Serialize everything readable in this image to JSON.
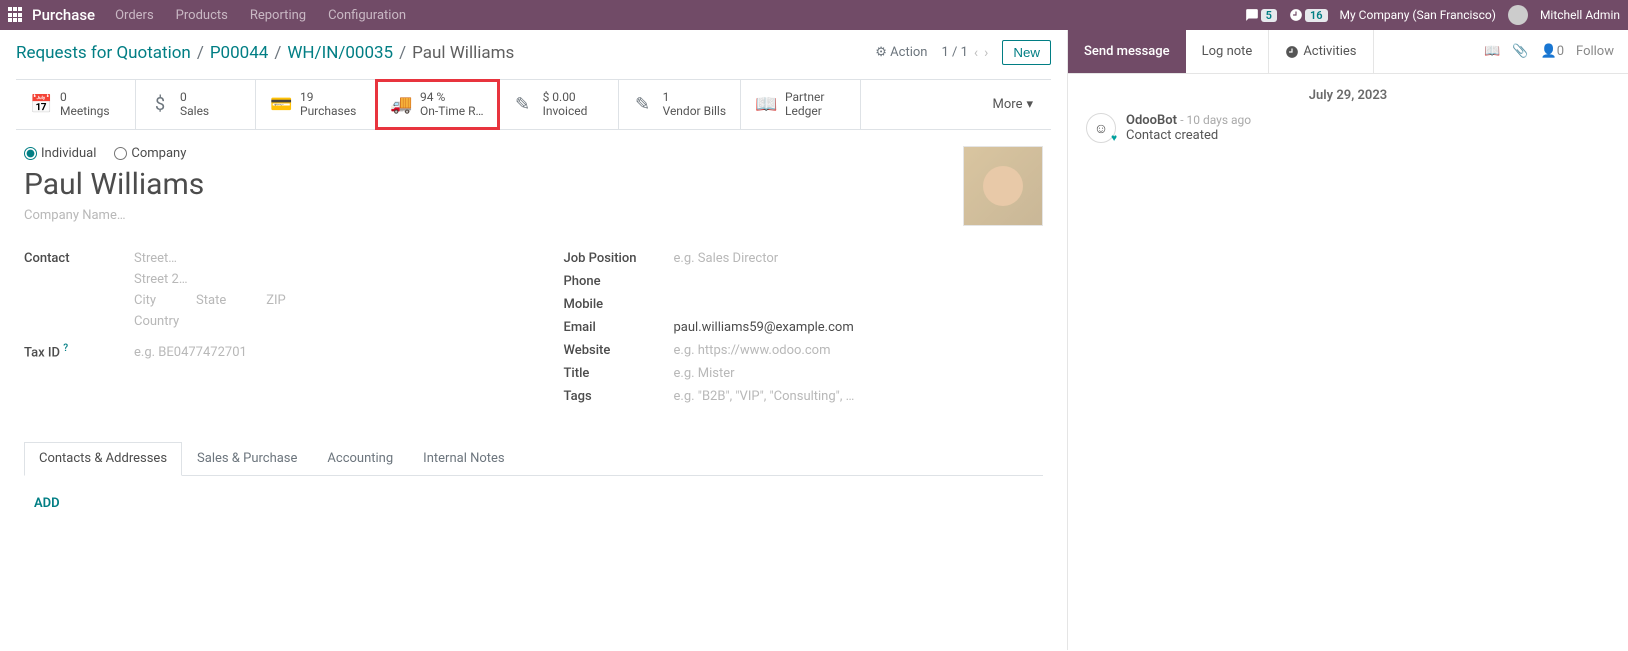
{
  "topbar": {
    "brand": "Purchase",
    "menu": [
      "Orders",
      "Products",
      "Reporting",
      "Configuration"
    ],
    "chat_count": "5",
    "clock_count": "16",
    "company": "My Company (San Francisco)",
    "user": "Mitchell Admin"
  },
  "breadcrumb": {
    "items": [
      "Requests for Quotation",
      "P00044",
      "WH/IN/00035"
    ],
    "current": "Paul Williams",
    "action_label": "Action",
    "pager": "1 / 1",
    "new_label": "New"
  },
  "stats": {
    "meetings": {
      "value": "0",
      "label": "Meetings"
    },
    "sales": {
      "value": "0",
      "label": "Sales"
    },
    "purchases": {
      "value": "19",
      "label": "Purchases"
    },
    "ontime": {
      "value": "94 %",
      "label": "On-Time R…"
    },
    "invoiced": {
      "value": "$ 0.00",
      "label": "Invoiced"
    },
    "vendorbills": {
      "value": "1",
      "label": "Vendor Bills"
    },
    "partnerledger": {
      "value": "Partner",
      "label": "Ledger"
    },
    "more": "More"
  },
  "form": {
    "radio_individual": "Individual",
    "radio_company": "Company",
    "name": "Paul Williams",
    "company_ph": "Company Name…",
    "contact_label": "Contact",
    "street_ph": "Street…",
    "street2_ph": "Street 2…",
    "city_ph": "City",
    "state_ph": "State",
    "zip_ph": "ZIP",
    "country_ph": "Country",
    "taxid_label": "Tax ID",
    "taxid_ph": "e.g. BE0477472701",
    "jobpos_label": "Job Position",
    "jobpos_ph": "e.g. Sales Director",
    "phone_label": "Phone",
    "mobile_label": "Mobile",
    "email_label": "Email",
    "email_value": "paul.williams59@example.com",
    "website_label": "Website",
    "website_ph": "e.g. https://www.odoo.com",
    "title_label": "Title",
    "title_ph": "e.g. Mister",
    "tags_label": "Tags",
    "tags_ph": "e.g. \"B2B\", \"VIP\", \"Consulting\", …"
  },
  "tabs": {
    "contacts": "Contacts & Addresses",
    "sales": "Sales & Purchase",
    "accounting": "Accounting",
    "notes": "Internal Notes",
    "add": "ADD"
  },
  "chatter": {
    "send": "Send message",
    "log": "Log note",
    "activities": "Activities",
    "follower_count": "0",
    "follow": "Follow",
    "date": "July 29, 2023",
    "author": "OdooBot",
    "ago": "- 10 days ago",
    "text": "Contact created"
  }
}
